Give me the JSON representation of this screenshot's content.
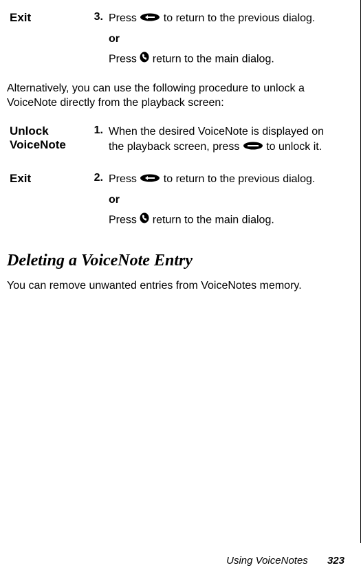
{
  "step1": {
    "label": "Exit",
    "num": "3.",
    "text_a": "Press ",
    "text_b": " to return to the previous dialog.",
    "or": "or",
    "text_c": "Press ",
    "text_d": " return to the main dialog."
  },
  "para1": "Alternatively, you can use the following procedure to unlock a VoiceNote directly from the playback screen:",
  "step2": {
    "label": "Unlock VoiceNote",
    "num": "1.",
    "text_a": "When the desired VoiceNote is displayed on the playback screen, press ",
    "text_b": " to unlock it."
  },
  "step3": {
    "label": "Exit",
    "num": "2.",
    "text_a": "Press ",
    "text_b": " to return to the previous dialog.",
    "or": "or",
    "text_c": "Press ",
    "text_d": " return to the main dialog."
  },
  "heading": "Deleting a VoiceNote Entry",
  "para2": "You can remove unwanted entries from VoiceNotes memory.",
  "footer": {
    "section": "Using VoiceNotes",
    "page": "323"
  }
}
